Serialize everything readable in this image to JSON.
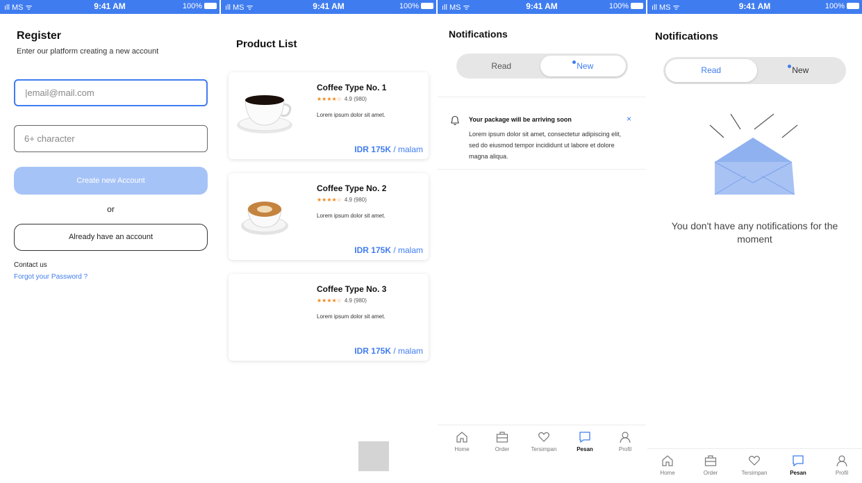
{
  "status_bar": {
    "signal": "ıll MS ᯤ",
    "time": "9:41 AM",
    "battery": "100%"
  },
  "register": {
    "title": "Register",
    "subtitle": "Enter our platform creating a new account",
    "email_placeholder": "|email@mail.com",
    "password_placeholder": "6+ character",
    "create_button": "Create new Account",
    "or": "or",
    "login_button": "Already have an account",
    "contact": "Contact us",
    "forgot": "Forgot your Password ?"
  },
  "product_list": {
    "title": "Product List",
    "products": [
      {
        "name": "Coffee Type No. 1",
        "stars": "★★★★☆",
        "rating": "4.9 (980)",
        "desc": "Lorem ipsum dolor sit amet.",
        "price": "IDR 175K",
        "unit": " / malam"
      },
      {
        "name": "Coffee Type No. 2",
        "stars": "★★★★☆",
        "rating": "4.9 (980)",
        "desc": "Lorem ipsum dolor sit amet.",
        "price": "IDR 175K",
        "unit": " / malam"
      },
      {
        "name": "Coffee Type No. 3",
        "stars": "★★★★☆",
        "rating": "4.9 (980)",
        "desc": "Lorem ipsum dolor sit amet.",
        "price": "IDR 175K",
        "unit": " / malam"
      }
    ]
  },
  "notifications_new": {
    "title": "Notifications",
    "tab_read": "Read",
    "tab_new": "New",
    "item": {
      "icon": "bell-icon",
      "heading": "Your package will be arriving soon",
      "body": "Lorem ipsum dolor sit amet, consectetur adipiscing elit, sed do eiusmod tempor incididunt ut labore et dolore magna aliqua.",
      "close": "×"
    }
  },
  "notifications_read": {
    "title": "Notifications",
    "tab_read": "Read",
    "tab_new": "New",
    "empty_icon": "open-envelope-icon",
    "empty_text": "You don't have any notifications for the moment"
  },
  "bottom_nav": {
    "items": [
      {
        "label": "Home",
        "icon": "home-icon"
      },
      {
        "label": "Order",
        "icon": "briefcase-icon"
      },
      {
        "label": "Tersimpan",
        "icon": "heart-icon"
      },
      {
        "label": "Pesan",
        "icon": "chat-icon"
      },
      {
        "label": "Profil",
        "icon": "user-icon"
      }
    ],
    "active": "Pesan"
  },
  "colors": {
    "accent": "#3f7cf0",
    "primary_disabled": "#a6c3f7",
    "star": "#f08a24"
  }
}
